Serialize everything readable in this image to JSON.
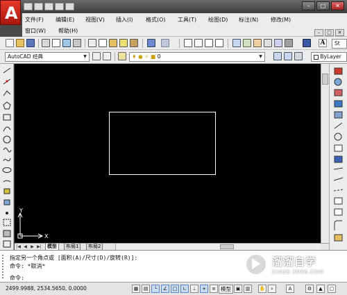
{
  "menus": {
    "row1": [
      "文件(F)",
      "编辑(E)",
      "视图(V)",
      "插入(I)",
      "格式(O)",
      "工具(T)",
      "绘图(D)",
      "标注(N)",
      "修改(M)"
    ],
    "row2": [
      "窗口(W)",
      "帮助(H)"
    ]
  },
  "toolbar": {
    "workspace": "AutoCAD 经典",
    "layer": "0",
    "linetype": "ByLayer",
    "style_btn": "St"
  },
  "tabs": {
    "nav": [
      "|◀",
      "◀",
      "▶",
      "▶|"
    ],
    "items": [
      "模型",
      "布局1",
      "布局2"
    ],
    "active": "模型"
  },
  "ucs": {
    "x_label": "X",
    "y_label": "Y"
  },
  "command": {
    "lines": [
      "指定另一个角点或 [面积(A)/尺寸(D)/旋转(R)]:",
      "命令: *取消*"
    ],
    "prompt": "命令:"
  },
  "status": {
    "coords": "2499.9988, 2534.5650, 0.0000",
    "model_label": "模型"
  },
  "watermark": {
    "title": "溜溜自学",
    "url": "ZIXUE.3D66.COM"
  },
  "colors": {
    "canvas_bg": "#000000",
    "rect_stroke": "#ffffff",
    "app_red": "#c8231a"
  }
}
